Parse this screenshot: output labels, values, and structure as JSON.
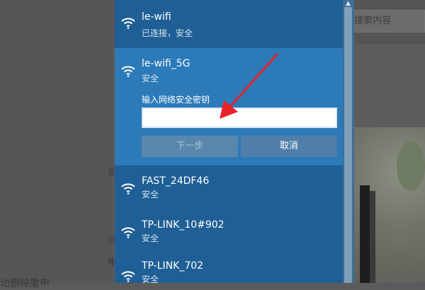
{
  "background": {
    "search_placeholder": "入搜索内容",
    "fragments": [
      "司",
      "问",
      "电",
      "动删除重申"
    ]
  },
  "flyout": {
    "networks": [
      {
        "name": "le-wifi",
        "status": "已连接，安全"
      },
      {
        "name": "le-wifi_5G",
        "status": "安全"
      },
      {
        "name": "FAST_24DF46",
        "status": "安全"
      },
      {
        "name": "TP-LINK_10#902",
        "status": "安全"
      },
      {
        "name": "TP-LINK_702",
        "status": "安全"
      }
    ],
    "selected_network_index": 1,
    "key_prompt": "输入网络安全密钥",
    "key_value": "",
    "next_label": "下一步",
    "cancel_label": "取消"
  },
  "colors": {
    "flyout_bg": "#1f5f95",
    "selected_bg": "#2c7ab8",
    "arrow": "#e8232a"
  },
  "icons": [
    "wifi-icon",
    "red-arrow-annotation"
  ]
}
